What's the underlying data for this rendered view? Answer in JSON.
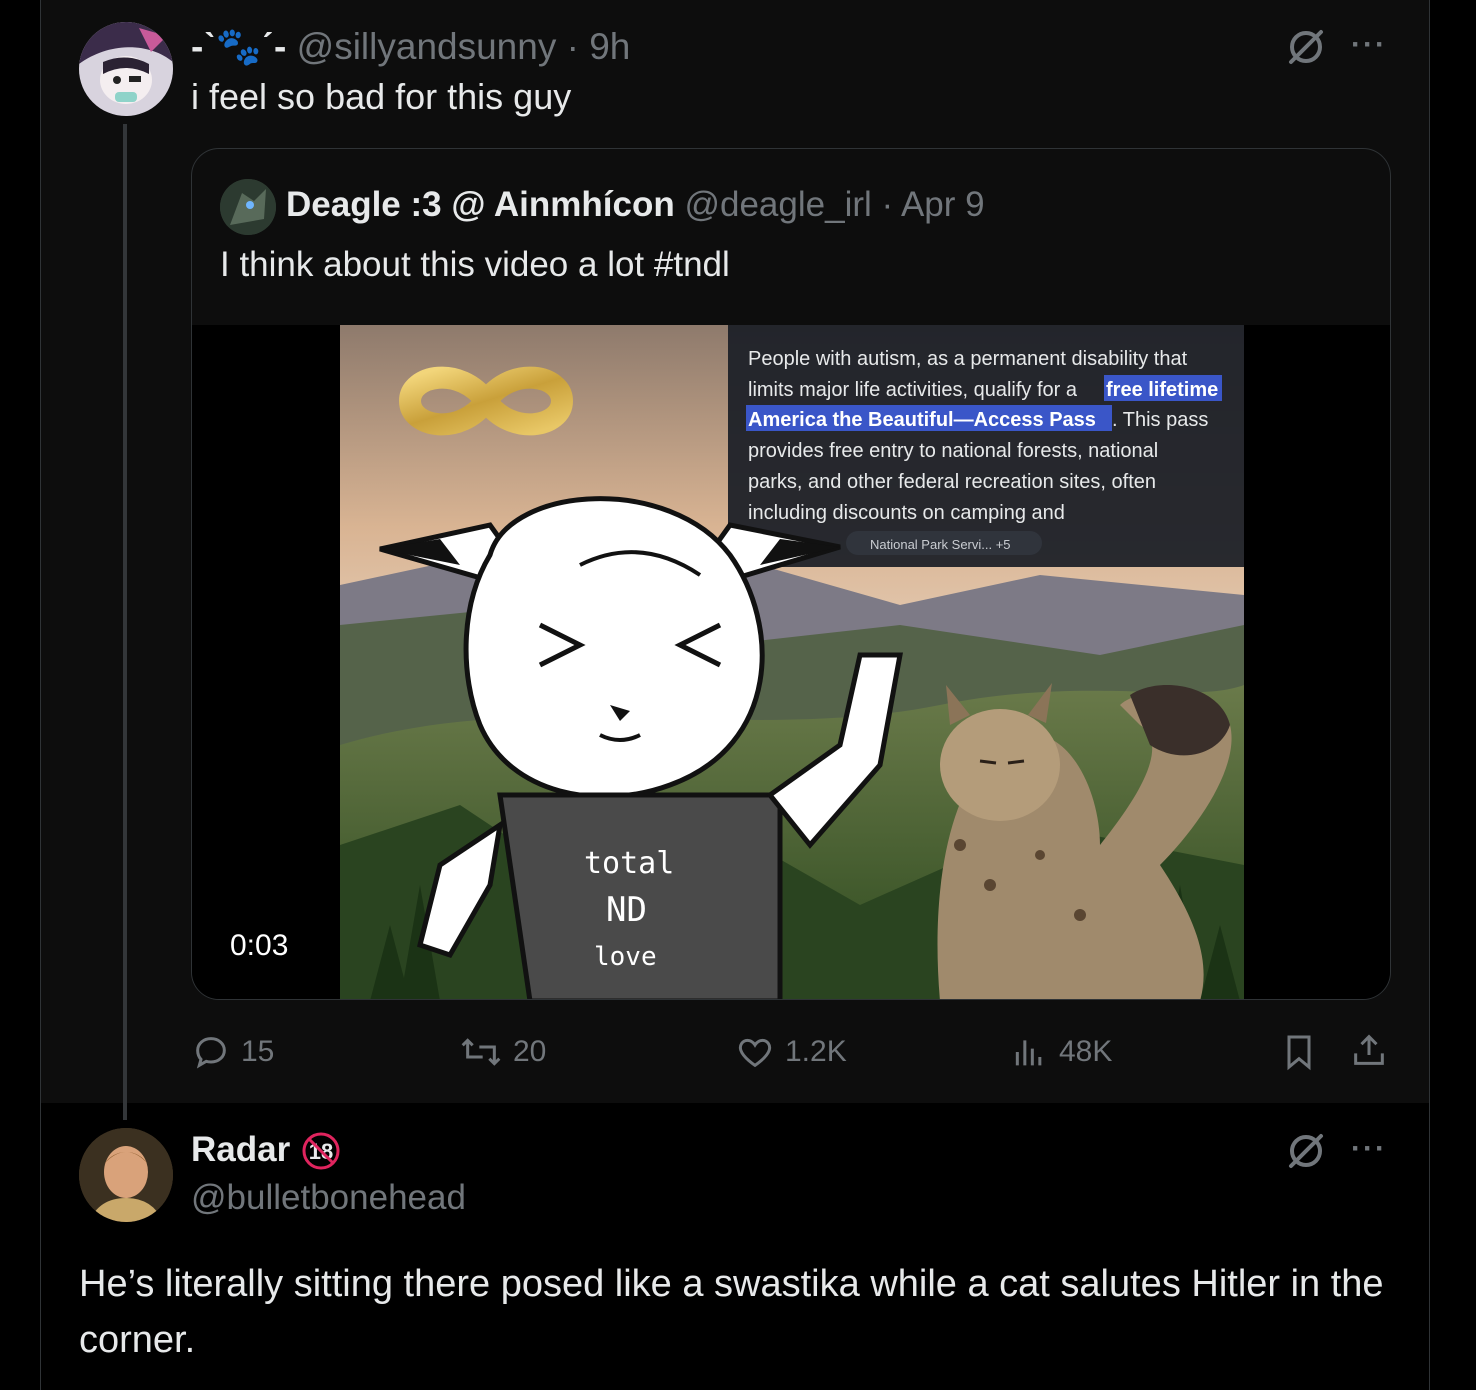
{
  "tweet1": {
    "display_name": "-ˋ🐾ˊ-",
    "handle": "@sillyandsunny",
    "time": "· 9h",
    "text": "i feel so bad for this guy",
    "more_label": "···"
  },
  "quote": {
    "display_name": "Deagle :3 @ Ainmhícon",
    "handle": "@deagle_irl",
    "time": "· Apr 9",
    "text": "I think about this video a lot #tndl",
    "video": {
      "timestamp": "0:03",
      "overlay_text_1": "People with autism, as a permanent disability that",
      "overlay_text_2": "limits major life activities, qualify for a ",
      "overlay_highlight_1": "free lifetime",
      "overlay_highlight_2": "America the Beautiful—Access Pass",
      "overlay_text_3": ". This pass",
      "overlay_text_4": "provides free entry to national forests, national",
      "overlay_text_5": "parks, and other federal recreation sites, often",
      "overlay_text_6": "including discounts on camping and",
      "overlay_source": "National Park Servi... +5",
      "shirt_line_1": "total",
      "shirt_line_2": "ND",
      "shirt_line_3": "love"
    }
  },
  "actions": {
    "replies": "15",
    "reposts": "20",
    "likes": "1.2K",
    "views": "48K"
  },
  "tweet2": {
    "display_name": "Radar",
    "badge": "18",
    "handle": "@bulletbonehead",
    "text": "He’s literally sitting there posed like a swastika while a cat salutes Hitler in the corner.",
    "more_label": "···"
  },
  "colors": {
    "background": "#000000",
    "tweet_bg": "#0d0d0d",
    "text": "#e7e9ea",
    "muted": "#71767b",
    "border": "#2f3336",
    "highlight": "#3a56c8"
  }
}
